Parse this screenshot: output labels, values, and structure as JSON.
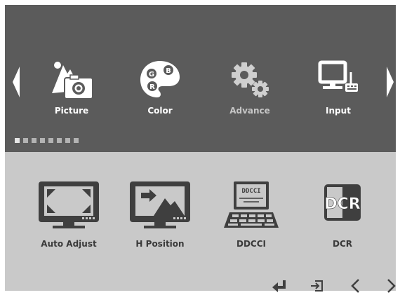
{
  "categories": [
    {
      "label": "Picture",
      "icon": "picture-icon"
    },
    {
      "label": "Color",
      "icon": "color-palette-icon"
    },
    {
      "label": "Advance",
      "icon": "gears-icon"
    },
    {
      "label": "Input",
      "icon": "input-computer-icon"
    }
  ],
  "color_icon_letters": [
    "G",
    "B",
    "R"
  ],
  "page_indicator": {
    "total": 8,
    "current": 1
  },
  "items": [
    {
      "label": "Auto Adjust",
      "icon": "auto-adjust-icon"
    },
    {
      "label": "H Position",
      "icon": "h-position-icon"
    },
    {
      "label": "DDCCI",
      "icon": "ddcci-icon",
      "screen_text": "DDCCI"
    },
    {
      "label": "DCR",
      "icon": "dcr-icon",
      "badge_text": "DCR"
    }
  ],
  "colors": {
    "top_panel": "#5b5b5b",
    "bottom_panel": "#c9c9c9",
    "icon_dark": "#3f3f3f"
  }
}
